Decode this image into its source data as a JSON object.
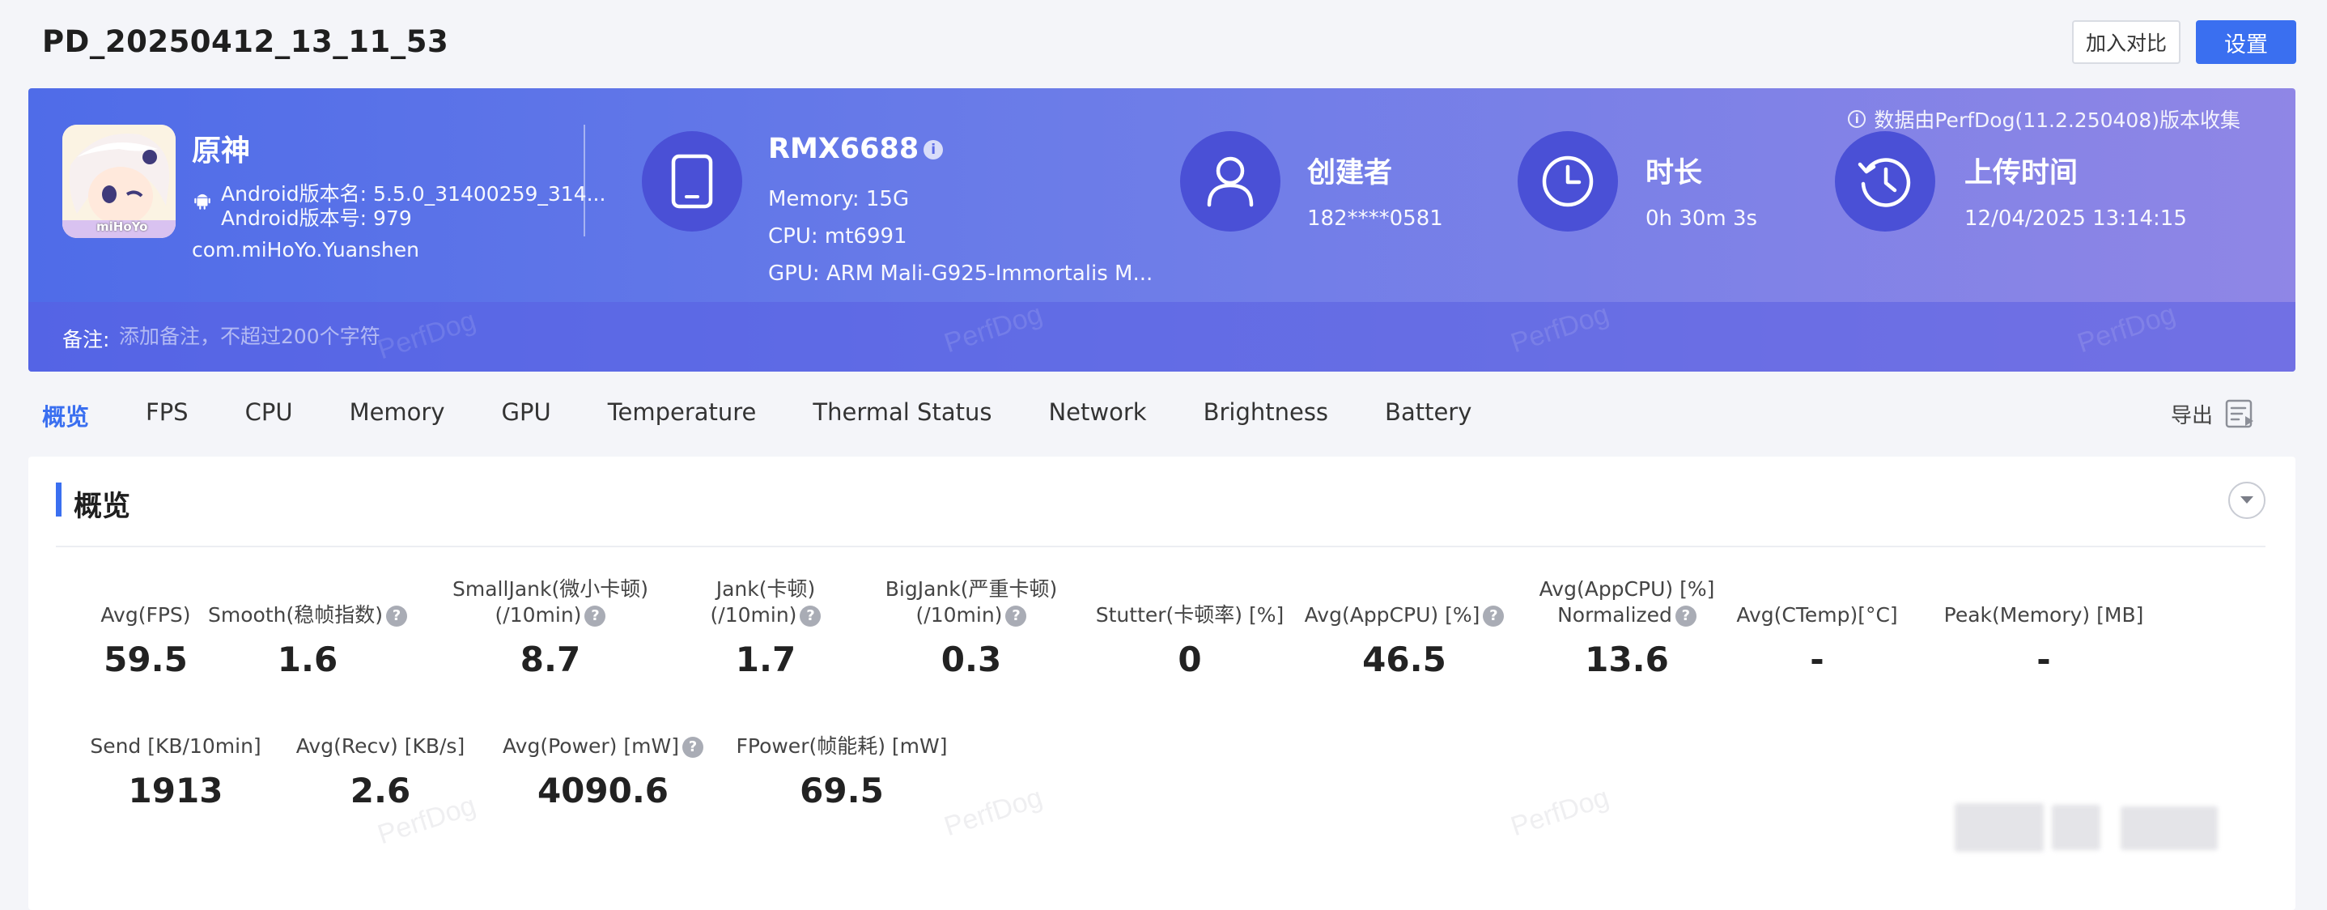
{
  "header": {
    "title": "PD_20250412_13_11_53",
    "compare_label": "加入对比",
    "settings_label": "设置"
  },
  "banner": {
    "source_note": "数据由PerfDog(11.2.250408)版本收集",
    "app": {
      "name": "原神",
      "icon_caption": "miHoYo",
      "version_name": "Android版本名: 5.5.0_31400259_314...",
      "version_code": "Android版本号: 979",
      "package": "com.miHoYo.Yuanshen"
    },
    "device": {
      "model": "RMX6688",
      "memory": "Memory: 15G",
      "cpu": "CPU: mt6991",
      "gpu": "GPU: ARM Mali-G925-Immortalis M..."
    },
    "creator": {
      "title": "创建者",
      "value": "182****0581"
    },
    "duration": {
      "title": "时长",
      "value": "0h 30m 3s"
    },
    "upload": {
      "title": "上传时间",
      "value": "12/04/2025 13:14:15"
    },
    "remark": {
      "label": "备注:",
      "placeholder": "添加备注，不超过200个字符"
    },
    "watermark": "PerfDog"
  },
  "tabs": [
    {
      "label": "概览",
      "active": true
    },
    {
      "label": "FPS"
    },
    {
      "label": "CPU"
    },
    {
      "label": "Memory"
    },
    {
      "label": "GPU"
    },
    {
      "label": "Temperature"
    },
    {
      "label": "Thermal Status"
    },
    {
      "label": "Network"
    },
    {
      "label": "Brightness"
    },
    {
      "label": "Battery"
    }
  ],
  "export_label": "导出",
  "panel": {
    "title": "概览",
    "metrics_row1": [
      {
        "label": [
          "Avg(FPS)"
        ],
        "value": "59.5"
      },
      {
        "label": [
          "Smooth(稳帧指数)"
        ],
        "help": true,
        "value": "1.6"
      },
      {
        "label": [
          "SmallJank(微小卡顿)",
          "(/10min)"
        ],
        "help": true,
        "value": "8.7"
      },
      {
        "label": [
          "Jank(卡顿)",
          "(/10min)"
        ],
        "help": true,
        "value": "1.7"
      },
      {
        "label": [
          "BigJank(严重卡顿)",
          "(/10min)"
        ],
        "help": true,
        "value": "0.3"
      },
      {
        "label": [
          "Stutter(卡顿率) [%]"
        ],
        "value": "0"
      },
      {
        "label": [
          "Avg(AppCPU) [%]"
        ],
        "help": true,
        "value": "46.5"
      },
      {
        "label": [
          "Avg(AppCPU) [%]",
          "Normalized"
        ],
        "help": true,
        "value": "13.6"
      },
      {
        "label": [
          "Avg(CTemp)[°C]"
        ],
        "value": "-"
      },
      {
        "label": [
          "Peak(Memory) [MB]"
        ],
        "value": "-"
      }
    ],
    "metrics_row2": [
      {
        "label": [
          "Send [KB/10min]"
        ],
        "value": "1913"
      },
      {
        "label": [
          "Avg(Recv) [KB/s]"
        ],
        "value": "2.6"
      },
      {
        "label": [
          "Avg(Power) [mW]"
        ],
        "help": true,
        "value": "4090.6"
      },
      {
        "label": [
          "FPower(帧能耗) [mW]"
        ],
        "value": "69.5"
      }
    ]
  }
}
